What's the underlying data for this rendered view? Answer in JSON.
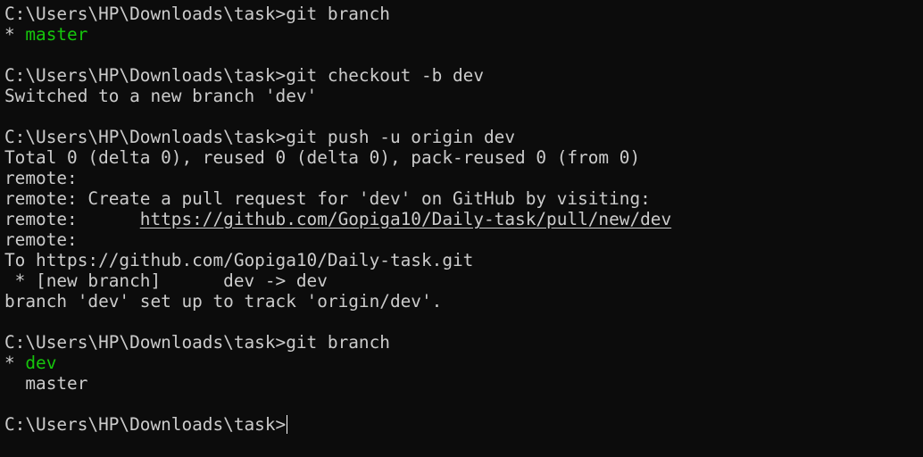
{
  "colors": {
    "background": "#0c0c0c",
    "foreground": "#cccccc",
    "branch_highlight": "#16c60c",
    "cursor": "#ffffff"
  },
  "terminal": {
    "lines": {
      "l0_prompt": "C:\\Users\\HP\\Downloads\\task>",
      "l0_cmd": "git branch",
      "l1_marker": "* ",
      "l1_branch": "master",
      "l3_prompt": "C:\\Users\\HP\\Downloads\\task>",
      "l3_cmd": "git checkout -b dev",
      "l4_text": "Switched to a new branch 'dev'",
      "l6_prompt": "C:\\Users\\HP\\Downloads\\task>",
      "l6_cmd": "git push -u origin dev",
      "l7_text": "Total 0 (delta 0), reused 0 (delta 0), pack-reused 0 (from 0)",
      "l8_text": "remote:",
      "l9_text": "remote: Create a pull request for 'dev' on GitHub by visiting:",
      "l10_prefix": "remote:      ",
      "l10_link": "https://github.com/Gopiga10/Daily-task/pull/new/dev",
      "l11_text": "remote:",
      "l12_text": "To https://github.com/Gopiga10/Daily-task.git",
      "l13_text": " * [new branch]      dev -> dev",
      "l14_text": "branch 'dev' set up to track 'origin/dev'.",
      "l16_prompt": "C:\\Users\\HP\\Downloads\\task>",
      "l16_cmd": "git branch",
      "l17_marker": "* ",
      "l17_branch": "dev",
      "l18_text": "  master",
      "l20_prompt": "C:\\Users\\HP\\Downloads\\task>"
    }
  }
}
